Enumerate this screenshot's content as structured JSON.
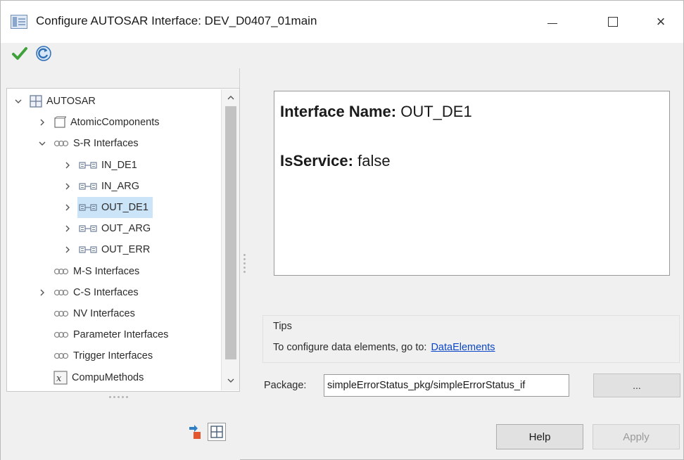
{
  "window": {
    "title": "Configure AUTOSAR Interface: DEV_D0407_01main",
    "minimize_glyph": "",
    "close_glyph": "×"
  },
  "toolbar": {
    "apply_icon": "checkmark-icon",
    "refresh_icon": "refresh-icon"
  },
  "tree": {
    "items": [
      {
        "label": "AUTOSAR",
        "level": 0,
        "expander": "expanded",
        "icon": "grid-icon"
      },
      {
        "label": "AtomicComponents",
        "level": 1,
        "expander": "collapsed",
        "icon": "component-icon"
      },
      {
        "label": "S-R Interfaces",
        "level": 1,
        "expander": "expanded",
        "icon": "interfaces-icon"
      },
      {
        "label": "IN_DE1",
        "level": 2,
        "expander": "collapsed",
        "icon": "sr-interface-icon"
      },
      {
        "label": "IN_ARG",
        "level": 2,
        "expander": "collapsed",
        "icon": "sr-interface-icon"
      },
      {
        "label": "OUT_DE1",
        "level": 2,
        "expander": "collapsed",
        "icon": "sr-interface-icon",
        "selected": true
      },
      {
        "label": "OUT_ARG",
        "level": 2,
        "expander": "collapsed",
        "icon": "sr-interface-icon"
      },
      {
        "label": "OUT_ERR",
        "level": 2,
        "expander": "collapsed",
        "icon": "sr-interface-icon"
      },
      {
        "label": "M-S Interfaces",
        "level": 1,
        "expander": "none",
        "icon": "interfaces-icon"
      },
      {
        "label": "C-S Interfaces",
        "level": 1,
        "expander": "collapsed",
        "icon": "interfaces-icon"
      },
      {
        "label": "NV Interfaces",
        "level": 1,
        "expander": "none",
        "icon": "interfaces-icon"
      },
      {
        "label": "Parameter Interfaces",
        "level": 1,
        "expander": "none",
        "icon": "interfaces-icon"
      },
      {
        "label": "Trigger Interfaces",
        "level": 1,
        "expander": "none",
        "icon": "interfaces-icon"
      },
      {
        "label": "CompuMethods",
        "level": 1,
        "expander": "none",
        "icon": "function-icon"
      }
    ]
  },
  "details": {
    "name_key": "Interface Name:",
    "name_value": "OUT_DE1",
    "service_key": "IsService:",
    "service_value": "false"
  },
  "tips": {
    "title": "Tips",
    "text": "To configure data elements, go to:",
    "link": "DataElements"
  },
  "package": {
    "label": "Package:",
    "value": "simpleErrorStatus_pkg/simpleErrorStatus_if",
    "browse_label": "..."
  },
  "buttons": {
    "help": "Help",
    "apply": "Apply"
  },
  "colors": {
    "selection": "#cce4f7",
    "link": "#0b46c9",
    "disabled_text": "#9a9a9a"
  }
}
